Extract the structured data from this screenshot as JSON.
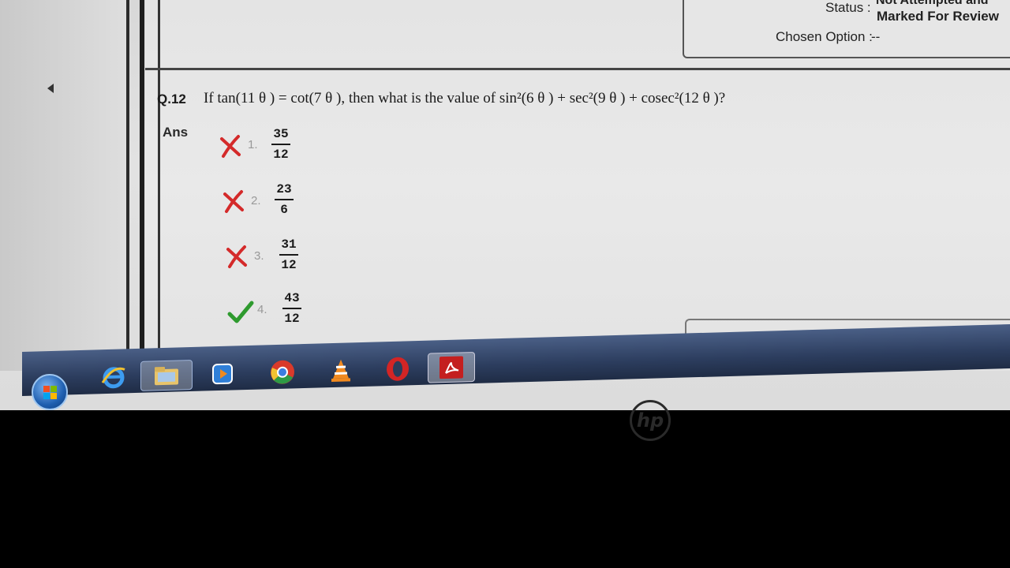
{
  "status": {
    "label": "Status :",
    "value_top": "Not Attempted and",
    "value": "Marked For Review"
  },
  "chosen": {
    "label": "Chosen Option :",
    "value": "--"
  },
  "question": {
    "number": "Q.12",
    "text": "If tan(11 θ ) = cot(7 θ ), then what is the value of sin²(6 θ ) + sec²(9 θ ) + cosec²(12 θ )?"
  },
  "answer": {
    "label": "Ans",
    "options": [
      {
        "num": "1.",
        "numerator": "35",
        "denominator": "12",
        "mark": "cross-icon"
      },
      {
        "num": "2.",
        "numerator": "23",
        "denominator": "6",
        "mark": "cross-icon"
      },
      {
        "num": "3.",
        "numerator": "31",
        "denominator": "12",
        "mark": "cross-icon"
      },
      {
        "num": "4.",
        "numerator": "43",
        "denominator": "12",
        "mark": "check-icon"
      }
    ]
  },
  "taskbar": {
    "icons": [
      "windows-start-icon",
      "internet-explorer-icon",
      "file-explorer-icon",
      "media-player-icon",
      "chrome-icon",
      "vlc-icon",
      "opera-icon",
      "acrobat-icon"
    ]
  },
  "colors": {
    "cross": "#d42a2a",
    "check": "#2e9a2e",
    "taskbar": "#2c3d5e"
  }
}
